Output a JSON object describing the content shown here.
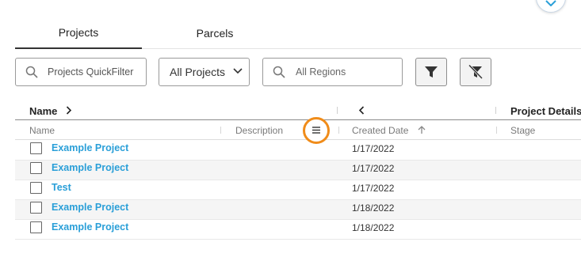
{
  "tabs": [
    {
      "label": "Projects",
      "active": true
    },
    {
      "label": "Parcels",
      "active": false
    }
  ],
  "toolbar": {
    "quickfilter_placeholder": "Projects QuickFilter",
    "project_select_value": "All Projects",
    "regions_placeholder": "All Regions",
    "filter_icon": "funnel-icon",
    "clear_filter_icon": "funnel-clear-icon"
  },
  "grid": {
    "group_headers": {
      "name": "Name",
      "details": "Project Details"
    },
    "columns": [
      "Name",
      "Description",
      "Created Date",
      "Stage"
    ],
    "sort": {
      "column": "Created Date",
      "direction": "ascending"
    },
    "rows": [
      {
        "name": "Example Project",
        "created": "1/17/2022"
      },
      {
        "name": "Example Project",
        "created": "1/17/2022"
      },
      {
        "name": "Test",
        "created": "1/17/2022"
      },
      {
        "name": "Example Project",
        "created": "1/18/2022"
      },
      {
        "name": "Example Project",
        "created": "1/18/2022"
      }
    ]
  },
  "colors": {
    "link": "#2a9fd8",
    "highlight_ring": "#f08c1a"
  }
}
